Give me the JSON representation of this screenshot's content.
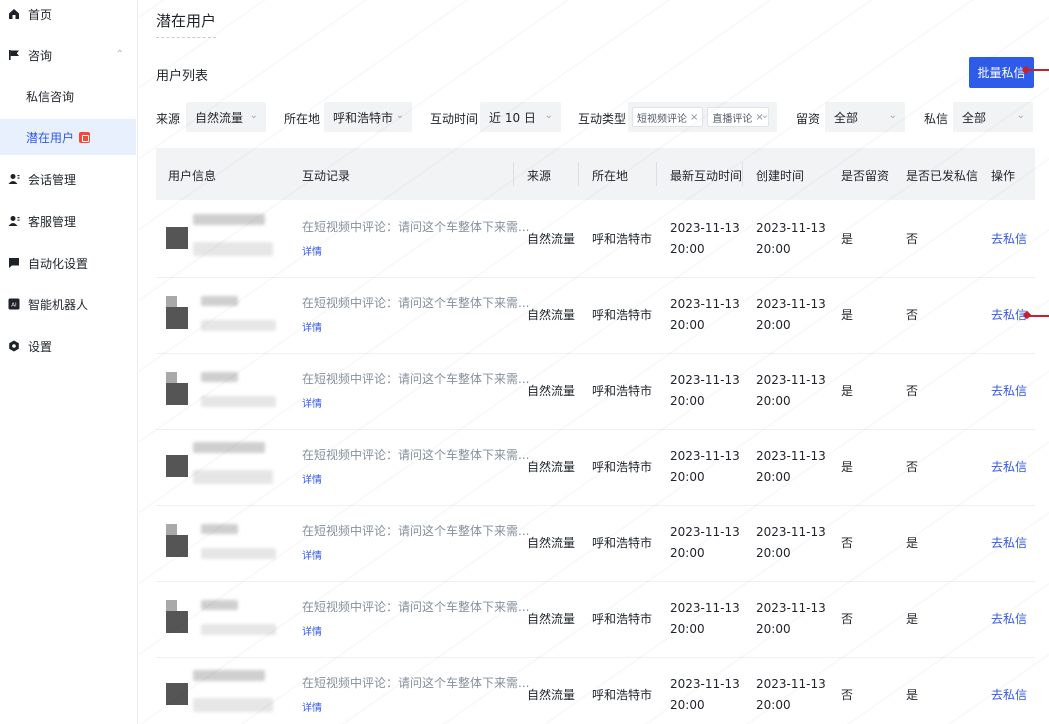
{
  "sidebar": {
    "items": [
      {
        "label": "首页",
        "icon": "home-icon"
      },
      {
        "label": "咨询",
        "icon": "flag-icon"
      },
      {
        "label": "私信咨询"
      },
      {
        "label": "潜在用户"
      },
      {
        "label": "会话管理",
        "icon": "person-icon"
      },
      {
        "label": "客服管理",
        "icon": "person-icon"
      },
      {
        "label": "自动化设置",
        "icon": "chat-icon"
      },
      {
        "label": "智能机器人",
        "icon": "ai-icon"
      },
      {
        "label": "设置",
        "icon": "gear-icon"
      }
    ],
    "accent": "#3058e8"
  },
  "page": {
    "title": "潜在用户",
    "section_title": "用户列表",
    "batch_button": "批量私信"
  },
  "filters": {
    "source_label": "来源",
    "source_value": "自然流量",
    "location_label": "所在地",
    "location_value": "呼和浩特市",
    "time_label": "互动时间",
    "time_value": "近 10 日",
    "type_label": "互动类型",
    "type_tags": [
      "短视频评论",
      "直播评论"
    ],
    "retained_label": "留资",
    "retained_value": "全部",
    "dm_label": "私信",
    "dm_value": "全部"
  },
  "table": {
    "headers": [
      "用户信息",
      "互动记录",
      "来源",
      "所在地",
      "最新互动时间",
      "创建时间",
      "是否留资",
      "是否已发私信",
      "操作"
    ],
    "rows": [
      {
        "record": "在短视频中评论：请问这个车整体下来需...",
        "detail": "详情",
        "source": "自然流量",
        "location": "呼和浩特市",
        "latest_date": "2023-11-13",
        "latest_time": "20:00",
        "created_date": "2023-11-13",
        "created_time": "20:00",
        "retained": "是",
        "dm_sent": "否",
        "action": "去私信"
      },
      {
        "record": "在短视频中评论：请问这个车整体下来需...",
        "detail": "详情",
        "source": "自然流量",
        "location": "呼和浩特市",
        "latest_date": "2023-11-13",
        "latest_time": "20:00",
        "created_date": "2023-11-13",
        "created_time": "20:00",
        "retained": "是",
        "dm_sent": "否",
        "action": "去私信"
      },
      {
        "record": "在短视频中评论：请问这个车整体下来需...",
        "detail": "详情",
        "source": "自然流量",
        "location": "呼和浩特市",
        "latest_date": "2023-11-13",
        "latest_time": "20:00",
        "created_date": "2023-11-13",
        "created_time": "20:00",
        "retained": "是",
        "dm_sent": "否",
        "action": "去私信"
      },
      {
        "record": "在短视频中评论：请问这个车整体下来需...",
        "detail": "详情",
        "source": "自然流量",
        "location": "呼和浩特市",
        "latest_date": "2023-11-13",
        "latest_time": "20:00",
        "created_date": "2023-11-13",
        "created_time": "20:00",
        "retained": "是",
        "dm_sent": "否",
        "action": "去私信"
      },
      {
        "record": "在短视频中评论：请问这个车整体下来需...",
        "detail": "详情",
        "source": "自然流量",
        "location": "呼和浩特市",
        "latest_date": "2023-11-13",
        "latest_time": "20:00",
        "created_date": "2023-11-13",
        "created_time": "20:00",
        "retained": "否",
        "dm_sent": "是",
        "action": "去私信"
      },
      {
        "record": "在短视频中评论：请问这个车整体下来需...",
        "detail": "详情",
        "source": "自然流量",
        "location": "呼和浩特市",
        "latest_date": "2023-11-13",
        "latest_time": "20:00",
        "created_date": "2023-11-13",
        "created_time": "20:00",
        "retained": "否",
        "dm_sent": "是",
        "action": "去私信"
      },
      {
        "record": "在短视频中评论：请问这个车整体下来需...",
        "detail": "详情",
        "source": "自然流量",
        "location": "呼和浩特市",
        "latest_date": "2023-11-13",
        "latest_time": "20:00",
        "created_date": "2023-11-13",
        "created_time": "20:00",
        "retained": "否",
        "dm_sent": "是",
        "action": "去私信"
      }
    ]
  },
  "colors": {
    "primary": "#2e5be8",
    "annotation_red": "#c8202f"
  }
}
